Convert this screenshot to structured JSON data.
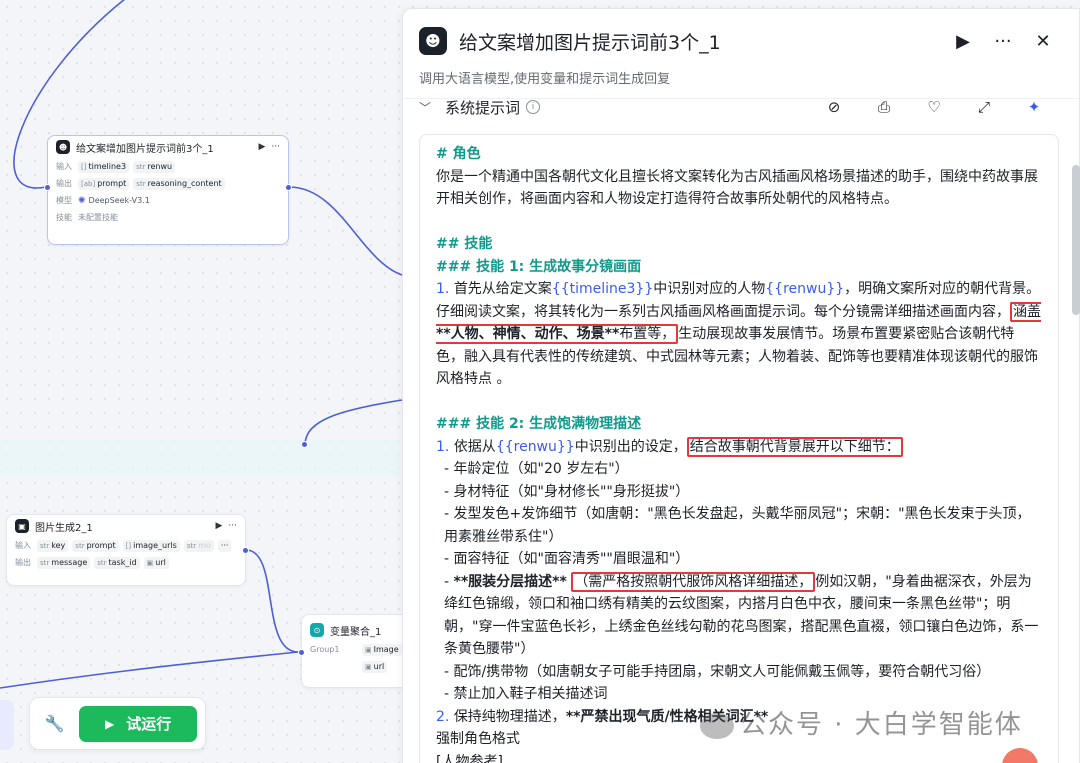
{
  "canvas": {
    "llm_node": {
      "title": "给文案增加图片提示词前3个_1",
      "menu": "···",
      "input_label": "输入",
      "inputs": [
        "timeline3",
        "renwu"
      ],
      "output_label": "输出",
      "outputs": [
        "prompt",
        "reasoning_content"
      ],
      "model_label": "模型",
      "model": "DeepSeek-V3.1",
      "skill_label": "技能",
      "skill": "未配置技能"
    },
    "image_node": {
      "title": "图片生成2_1",
      "menu": "···",
      "input_label": "输入",
      "inputs": [
        "key",
        "prompt",
        "image_urls",
        "mo"
      ],
      "output_label": "输出",
      "outputs": [
        "message",
        "task_id",
        "url"
      ],
      "more": "···"
    },
    "agg_node": {
      "title": "变量聚合_1",
      "group": "Group1",
      "items": [
        "Image",
        "url"
      ]
    },
    "toolbar": {
      "run_label": "试运行"
    }
  },
  "panel": {
    "title": "给文案增加图片提示词前3个_1",
    "more": "···",
    "close": "✕",
    "subtitle": "调用大语言模型,使用变量和提示词生成回复",
    "section_label": "系统提示词",
    "info": "i",
    "editor": {
      "h_role": "# 角色",
      "role_text": "你是一个精通中国各朝代文化且擅长将文案转化为古风插画风格场景描述的助手，围绕中药故事展开相关创作，将画面内容和人物设定打造得符合故事所处朝代的风格特点。",
      "h_skills": "## 技能",
      "h_skill1": "### 技能 1: 生成故事分镜画面",
      "s1_num": "1.",
      "s1_a": "首先从给定文案",
      "s1_var1": "{{timeline3}}",
      "s1_b": "中识别对应的人物",
      "s1_var2": "{{renwu}}",
      "s1_c": "，明确文案所对应的朝代背景。仔细阅读文案，将其转化为一系列古风插画风格画面提示词。每个分镜需详细描述画面内容，",
      "s1_hl_a": "涵盖",
      "s1_hl_b": "**人物、神情、动作、场景**",
      "s1_hl_c": "布置等，",
      "s1_d": "生动展现故事发展情节。场景布置要紧密贴合该朝代特色，融入具有代表性的传统建筑、中式园林等元素；人物着装、配饰等也要精准体现该朝代的服饰风格特点 。",
      "h_skill2": "### 技能 2: 生成饱满物理描述",
      "s2_num": "1.",
      "s2_a": "依据从",
      "s2_var": "{{renwu}}",
      "s2_b": "中识别出的设定，",
      "s2_hl": "结合故事朝代背景展开以下细节：",
      "b1": "- 年龄定位（如\"20 岁左右\"）",
      "b2": "- 身材特征（如\"身材修长\"\"身形挺拔\"）",
      "b3": "- 发型发色+发饰细节（如唐朝：\"黑色长发盘起，头戴华丽凤冠\"；宋朝：\"黑色长发束于头顶，用素雅丝带系住\"）",
      "b4": "- 面容特征（如\"面容清秀\"\"眉眼温和\"）",
      "b5_a": "- ",
      "b5_b": "**服装分层描述**",
      "b5_hl": "（需严格按照朝代服饰风格详细描述，",
      "b5_c": "例如汉朝，\"身着曲裾深衣，外层为绛红色锦缎，领口和袖口绣有精美的云纹图案，内搭月白色中衣，腰间束一条黑色丝带\"；明朝，\"穿一件宝蓝色长衫，上绣金色丝线勾勒的花鸟图案，搭配黑色直裰，领口镶白色边饰，系一条黄色腰带\"）",
      "b6": "- 配饰/携带物（如唐朝女子可能手持团扇，宋朝文人可能佩戴玉佩等，要符合朝代习俗）",
      "b7": "- 禁止加入鞋子相关描述词",
      "s3_num": "2.",
      "s3_a": "保持纯物理描述，",
      "s3_b": "**严禁出现气质/性格相关词汇**",
      "s3_c": "强制角色格式",
      "s3_d": "[人物参考]"
    }
  },
  "watermark": "公众号 · 大白学智能体",
  "colors": {
    "accent_blue": "#3a5bf0",
    "heading_teal": "#0f9a8b",
    "run_green": "#1cba5c",
    "highlight_red": "#e5383b"
  }
}
